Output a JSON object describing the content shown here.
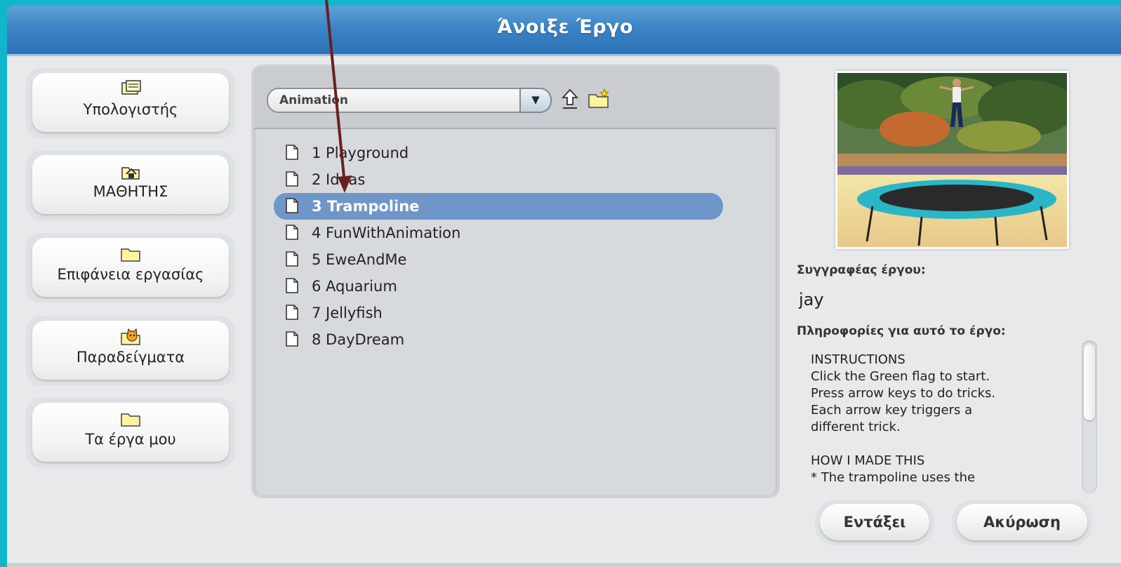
{
  "dialog": {
    "title": "Άνοιξε Έργο"
  },
  "locations": [
    {
      "label": "Υπολογιστής",
      "icon": "computer-icon"
    },
    {
      "label": "ΜΑΘΗΤΗΣ",
      "icon": "home-folder-icon"
    },
    {
      "label": "Επιφάνεια εργασίας",
      "icon": "folder-icon"
    },
    {
      "label": "Παραδείγματα",
      "icon": "scratch-cat-icon"
    },
    {
      "label": "Τα έργα μου",
      "icon": "folder-icon"
    }
  ],
  "browser": {
    "current_folder": "Animation",
    "files": [
      {
        "name": "1 Playground",
        "selected": false
      },
      {
        "name": "2 Ideas",
        "selected": false
      },
      {
        "name": "3 Trampoline",
        "selected": true
      },
      {
        "name": "4 FunWithAnimation",
        "selected": false
      },
      {
        "name": "5 EweAndMe",
        "selected": false
      },
      {
        "name": "6 Aquarium",
        "selected": false
      },
      {
        "name": "7 Jellyfish",
        "selected": false
      },
      {
        "name": "8 DayDream",
        "selected": false
      }
    ]
  },
  "details": {
    "author_label": "Συγγραφέας έργου:",
    "author": "jay",
    "info_label": "Πληροφορίες για αυτό το έργο:",
    "notes": "INSTRUCTIONS\nClick the Green flag to start.\nPress arrow keys to do tricks.\nEach arrow key triggers a\ndifferent trick.\n\nHOW I MADE THIS\n* The trampoline uses the\nfisheye effect to make it look"
  },
  "buttons": {
    "ok": "Εντάξει",
    "cancel": "Ακύρωση"
  },
  "colors": {
    "title_bar": "#3b84c6",
    "selection": "#6f96c9",
    "annotation_arrow": "#6b1f1f"
  }
}
